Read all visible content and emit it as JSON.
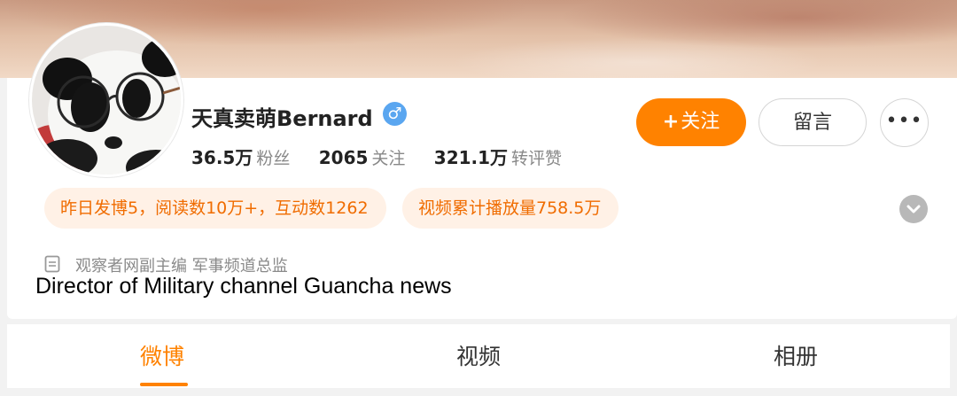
{
  "profile": {
    "name": "天真卖萌Bernard",
    "gender_symbol": "♂",
    "stats": [
      {
        "value": "36.5万",
        "label": "粉丝"
      },
      {
        "value": "2065",
        "label": "关注"
      },
      {
        "value": "321.1万",
        "label": "转评赞"
      }
    ]
  },
  "actions": {
    "follow_plus": "+",
    "follow_label": "关注",
    "message_label": "留言",
    "more_label": "•••"
  },
  "highlights": {
    "yesterday": "昨日发博5，阅读数10万+，互动数1262",
    "video": "视频累计播放量758.5万"
  },
  "bio": {
    "text": "观察者网副主编 军事频道总监",
    "caption": "Director of Military channel Guancha news"
  },
  "tabs": [
    {
      "label": "微博",
      "active": true
    },
    {
      "label": "视频",
      "active": false
    },
    {
      "label": "相册",
      "active": false
    }
  ],
  "colors": {
    "accent": "#ff8200",
    "pill_bg": "#fff1e6",
    "gender": "#5aa6f0"
  }
}
